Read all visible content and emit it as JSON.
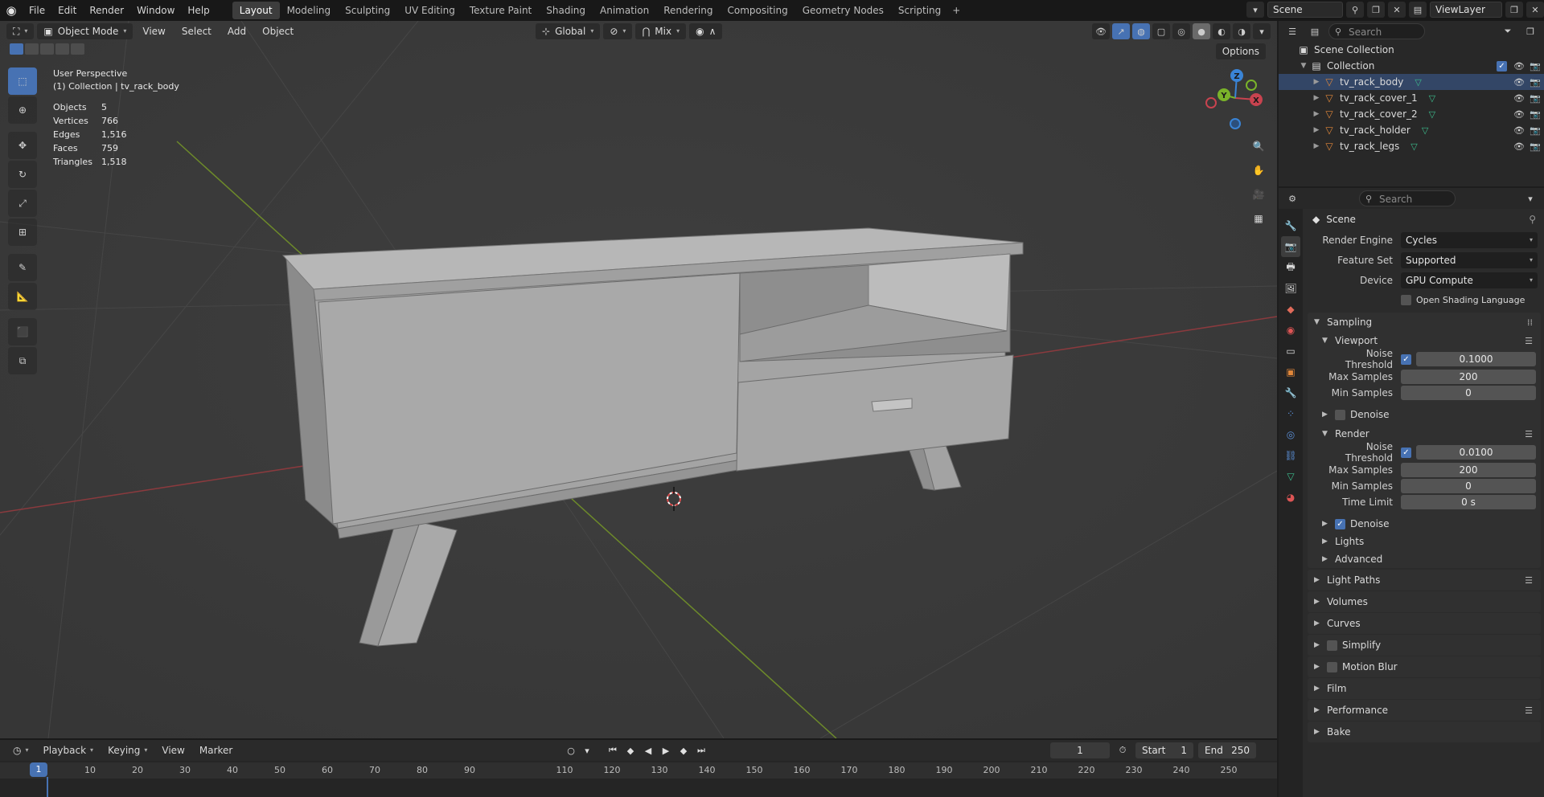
{
  "topbar": {
    "menus": [
      "File",
      "Edit",
      "Render",
      "Window",
      "Help"
    ],
    "workspaces": [
      "Layout",
      "Modeling",
      "Sculpting",
      "UV Editing",
      "Texture Paint",
      "Shading",
      "Animation",
      "Rendering",
      "Compositing",
      "Geometry Nodes",
      "Scripting"
    ],
    "active_workspace": "Layout",
    "add_tab": "+",
    "scene": "Scene",
    "view_layer": "ViewLayer"
  },
  "viewport": {
    "mode": "Object Mode",
    "menus": [
      "View",
      "Select",
      "Add",
      "Object"
    ],
    "orientation": "Global",
    "snap_mode": "Mix",
    "options": "Options",
    "perspective": "User Perspective",
    "context": "(1) Collection | tv_rack_body",
    "stats": [
      {
        "label": "Objects",
        "value": "5"
      },
      {
        "label": "Vertices",
        "value": "766"
      },
      {
        "label": "Edges",
        "value": "1,516"
      },
      {
        "label": "Faces",
        "value": "759"
      },
      {
        "label": "Triangles",
        "value": "1,518"
      }
    ],
    "gizmo": {
      "x": "X",
      "y": "Y",
      "z": "Z"
    }
  },
  "timeline": {
    "menus": [
      "Playback",
      "Keying",
      "View",
      "Marker"
    ],
    "current_frame": "1",
    "start_label": "Start",
    "start": "1",
    "end_label": "End",
    "end": "250",
    "ticks": [
      "10",
      "20",
      "30",
      "40",
      "50",
      "60",
      "70",
      "80",
      "90",
      "110",
      "120",
      "130",
      "140",
      "150",
      "160",
      "170",
      "180",
      "190",
      "200",
      "210",
      "220",
      "230",
      "240",
      "250"
    ],
    "playhead": "1"
  },
  "outliner": {
    "search_placeholder": "Search",
    "root": "Scene Collection",
    "collection": "Collection",
    "items": [
      "tv_rack_body",
      "tv_rack_cover_1",
      "tv_rack_cover_2",
      "tv_rack_holder",
      "tv_rack_legs"
    ]
  },
  "properties": {
    "search_placeholder": "Search",
    "context": "Scene",
    "render_engine_label": "Render Engine",
    "render_engine": "Cycles",
    "feature_set_label": "Feature Set",
    "feature_set": "Supported",
    "device_label": "Device",
    "device": "GPU Compute",
    "osl_label": "Open Shading Language",
    "sampling": {
      "title": "Sampling",
      "viewport": {
        "title": "Viewport",
        "noise_threshold_label": "Noise Threshold",
        "noise_threshold": "0.1000",
        "max_samples_label": "Max Samples",
        "max_samples": "200",
        "min_samples_label": "Min Samples",
        "min_samples": "0",
        "denoise_label": "Denoise"
      },
      "render": {
        "title": "Render",
        "noise_threshold_label": "Noise Threshold",
        "noise_threshold": "0.0100",
        "max_samples_label": "Max Samples",
        "max_samples": "200",
        "min_samples_label": "Min Samples",
        "min_samples": "0",
        "time_limit_label": "Time Limit",
        "time_limit": "0 s",
        "denoise_label": "Denoise"
      },
      "lights": "Lights",
      "advanced": "Advanced"
    },
    "panels": [
      "Light Paths",
      "Volumes",
      "Curves",
      "Simplify",
      "Motion Blur",
      "Film",
      "Performance",
      "Bake"
    ]
  },
  "colors": {
    "accent": "#4772b3",
    "x_axis": "#c8434f",
    "y_axis": "#7ab32a",
    "z_axis": "#3a84d6",
    "mesh_icon": "#3dbd8d",
    "object_icon": "#e0873a"
  }
}
